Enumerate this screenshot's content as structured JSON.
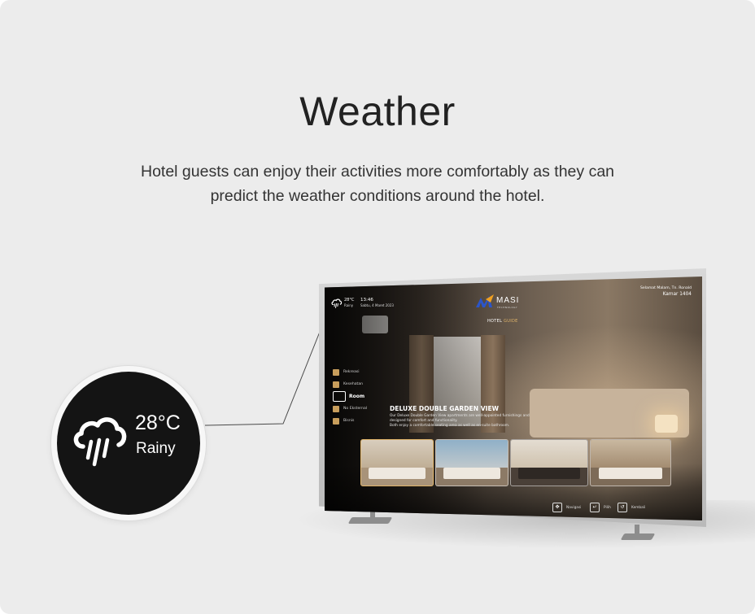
{
  "page": {
    "title": "Weather",
    "description_line1": "Hotel guests can enjoy their activities more comfortably as they can",
    "description_line2": "predict the weather conditions around the hotel."
  },
  "badge": {
    "temperature": "28°C",
    "condition": "Rainy",
    "icon": "rain-cloud-icon"
  },
  "tv_screen": {
    "weather": {
      "temperature": "28°C",
      "condition": "Rainy"
    },
    "time": "13:46",
    "date": "Sabtu, 4 Maret 2023",
    "logo": {
      "name": "MASI",
      "subtitle": "TECHNOLOGY"
    },
    "greeting": "Selamat Malam, Tn. Ronald",
    "room": "Kamar 1404",
    "guide_label_1": "HOTEL",
    "guide_label_2": "GUIDE",
    "menu": [
      {
        "label": "Rekreasi",
        "active": false,
        "icon": "recreation-icon"
      },
      {
        "label": "Kesehatan",
        "active": false,
        "icon": "heart-icon"
      },
      {
        "label": "Room",
        "active": true,
        "icon": "bed-icon"
      },
      {
        "label": "No Eksternal",
        "active": false,
        "icon": "phone-icon"
      },
      {
        "label": "Bisnis",
        "active": false,
        "icon": "briefcase-icon"
      }
    ],
    "feature_title": "DELUXE DOUBLE GARDEN VIEW",
    "feature_desc_1": "Our Deluxe Double Garden View apartments are well-appointed furnishings and",
    "feature_desc_2": "designed for comfort and functionality.",
    "feature_desc_3": "Both enjoy a comfortable seating area as well as en-suite bathroom.",
    "nav": [
      {
        "label": "Navigasi",
        "icon": "dpad-icon"
      },
      {
        "label": "Pilih",
        "icon": "enter-icon"
      },
      {
        "label": "Kembali",
        "icon": "back-icon"
      }
    ]
  },
  "colors": {
    "card_bg": "#ececec",
    "badge_bg": "#141414",
    "accent_gold": "#e0b46a",
    "logo_blue": "#2b55c9",
    "logo_orange": "#f0a020"
  }
}
